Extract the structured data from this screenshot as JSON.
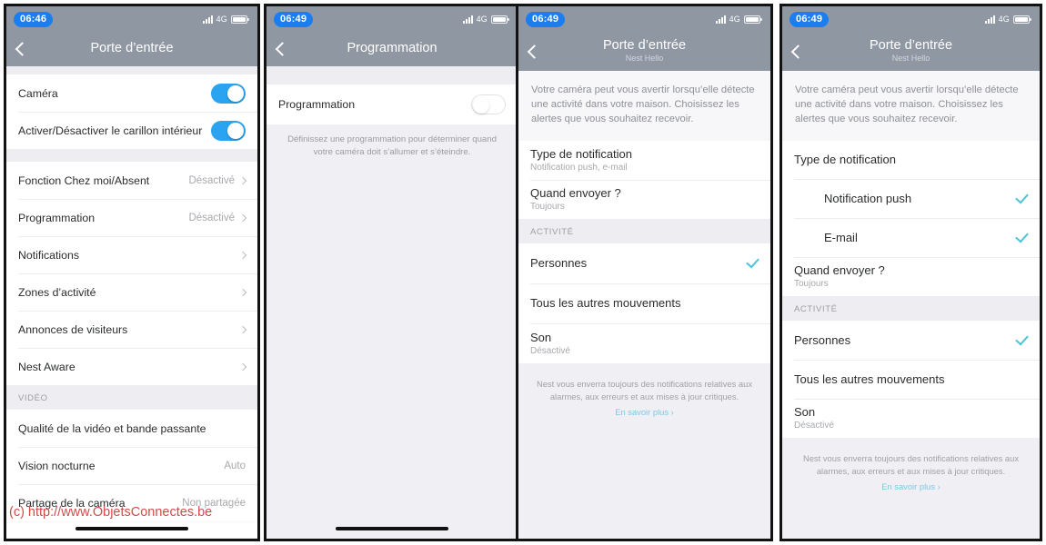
{
  "status": {
    "time1": "06:46",
    "time2": "06:49",
    "network": "4G"
  },
  "watermark": "(c) http://www.ObjetsConnectes.be",
  "panel1": {
    "nav": {
      "title": "Porte d’entrée"
    },
    "rows": {
      "camera": {
        "label": "Caméra",
        "toggle": "on"
      },
      "chime": {
        "label": "Activer/Désactiver le carillon intérieur",
        "toggle": "on"
      },
      "home_away": {
        "label": "Fonction Chez moi/Absent",
        "value": "Désactivé"
      },
      "schedule": {
        "label": "Programmation",
        "value": "Désactivé"
      },
      "notifications": {
        "label": "Notifications"
      },
      "activity_zones": {
        "label": "Zones d’activité"
      },
      "visitor_announcements": {
        "label": "Annonces de visiteurs"
      },
      "nest_aware": {
        "label": "Nest Aware"
      }
    },
    "section_video": "VIDÉO",
    "video_rows": {
      "quality": {
        "label": "Qualité de la vidéo et bande passante"
      },
      "night_vision": {
        "label": "Vision nocturne",
        "value": "Auto"
      },
      "sharing": {
        "label": "Partage de la caméra",
        "value": "Non partagée"
      }
    }
  },
  "panel2": {
    "nav": {
      "title": "Programmation"
    },
    "rows": {
      "schedule": {
        "label": "Programmation",
        "toggle": "off"
      }
    },
    "hint": "Définissez une programmation pour déterminer quand votre caméra doit s’allumer et s’éteindre."
  },
  "panel3": {
    "nav": {
      "title": "Porte d’entrée",
      "subtitle": "Nest Hello"
    },
    "description": "Votre caméra peut vous avertir lorsqu’elle détecte une activité dans votre maison. Choisissez les alertes que vous souhaitez recevoir.",
    "rows": {
      "type": {
        "label": "Type de notification",
        "sub": "Notification push, e-mail"
      },
      "when": {
        "label": "Quand envoyer ?",
        "sub": "Toujours"
      }
    },
    "section_activity": "ACTIVITÉ",
    "activity": {
      "people": {
        "label": "Personnes",
        "checked": true
      },
      "other_motion": {
        "label": "Tous les autres mouvements",
        "checked": false
      },
      "sound": {
        "label": "Son",
        "sub": "Désactivé",
        "checked": false
      }
    },
    "footnote": "Nest vous enverra toujours des notifications relatives aux alarmes, aux erreurs et aux mises à jour critiques.",
    "footnote_link": "En savoir plus ›"
  },
  "panel4": {
    "nav": {
      "title": "Porte d’entrée",
      "subtitle": "Nest Hello"
    },
    "description": "Votre caméra peut vous avertir lorsqu’elle détecte une activité dans votre maison. Choisissez les alertes que vous souhaitez recevoir.",
    "rows": {
      "type": {
        "label": "Type de notification"
      },
      "push": {
        "label": "Notification push",
        "checked": true
      },
      "email": {
        "label": "E-mail",
        "checked": true
      },
      "when": {
        "label": "Quand envoyer ?",
        "sub": "Toujours"
      }
    },
    "section_activity": "ACTIVITÉ",
    "activity": {
      "people": {
        "label": "Personnes",
        "checked": true
      },
      "other_motion": {
        "label": "Tous les autres mouvements",
        "checked": false
      },
      "sound": {
        "label": "Son",
        "sub": "Désactivé",
        "checked": false
      }
    },
    "footnote": "Nest vous enverra toujours des notifications relatives aux alarmes, aux erreurs et aux mises à jour critiques.",
    "footnote_link": "En savoir plus ›"
  }
}
